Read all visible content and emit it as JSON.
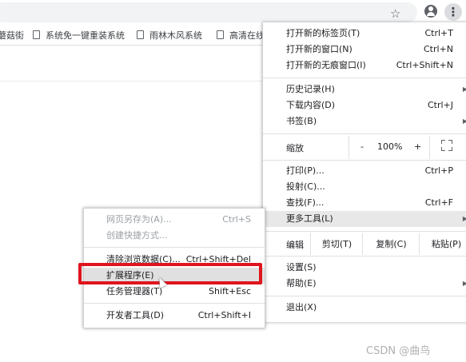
{
  "bookmarks": [
    {
      "label": "蘑菇街"
    },
    {
      "label": "系统免一键重装系统"
    },
    {
      "label": "雨林木风系统"
    },
    {
      "label": "高清在线"
    }
  ],
  "main_menu": {
    "new_tab": {
      "label": "打开新的标签页(T)",
      "shortcut": "Ctrl+T"
    },
    "new_window": {
      "label": "打开新的窗口(N)",
      "shortcut": "Ctrl+N"
    },
    "new_incognito": {
      "label": "打开新的无痕窗口(I)",
      "shortcut": "Ctrl+Shift+N"
    },
    "history": {
      "label": "历史记录(H)"
    },
    "downloads": {
      "label": "下载内容(D)",
      "shortcut": "Ctrl+J"
    },
    "bookmarks": {
      "label": "书签(B)"
    },
    "zoom": {
      "label": "缩放",
      "minus": "-",
      "value": "100%",
      "plus": "+"
    },
    "print": {
      "label": "打印(P)...",
      "shortcut": "Ctrl+P"
    },
    "cast": {
      "label": "投射(C)..."
    },
    "find": {
      "label": "查找(F)...",
      "shortcut": "Ctrl+F"
    },
    "more_tools": {
      "label": "更多工具(L)"
    },
    "edit": {
      "label": "编辑",
      "cut": "剪切(T)",
      "copy": "复制(C)",
      "paste": "粘贴(P)"
    },
    "settings": {
      "label": "设置(S)"
    },
    "help": {
      "label": "帮助(E)"
    },
    "exit": {
      "label": "退出(X)"
    }
  },
  "sub_menu": {
    "save_page": {
      "label": "网页另存为(A)...",
      "shortcut": "Ctrl+S"
    },
    "create_shortcut": {
      "label": "创建快捷方式..."
    },
    "clear_data": {
      "label": "清除浏览数据(C)...",
      "shortcut": "Ctrl+Shift+Del"
    },
    "extensions": {
      "label": "扩展程序(E)"
    },
    "task_manager": {
      "label": "任务管理器(T)",
      "shortcut": "Shift+Esc"
    },
    "dev_tools": {
      "label": "开发者工具(D)",
      "shortcut": "Ctrl+Shift+I"
    }
  },
  "icons": {
    "star": "☆",
    "kebab": "⋮",
    "arrow": "▶"
  },
  "watermark": "CSDN @曲鸟",
  "colors": {
    "highlight_box": "#e0141e"
  }
}
